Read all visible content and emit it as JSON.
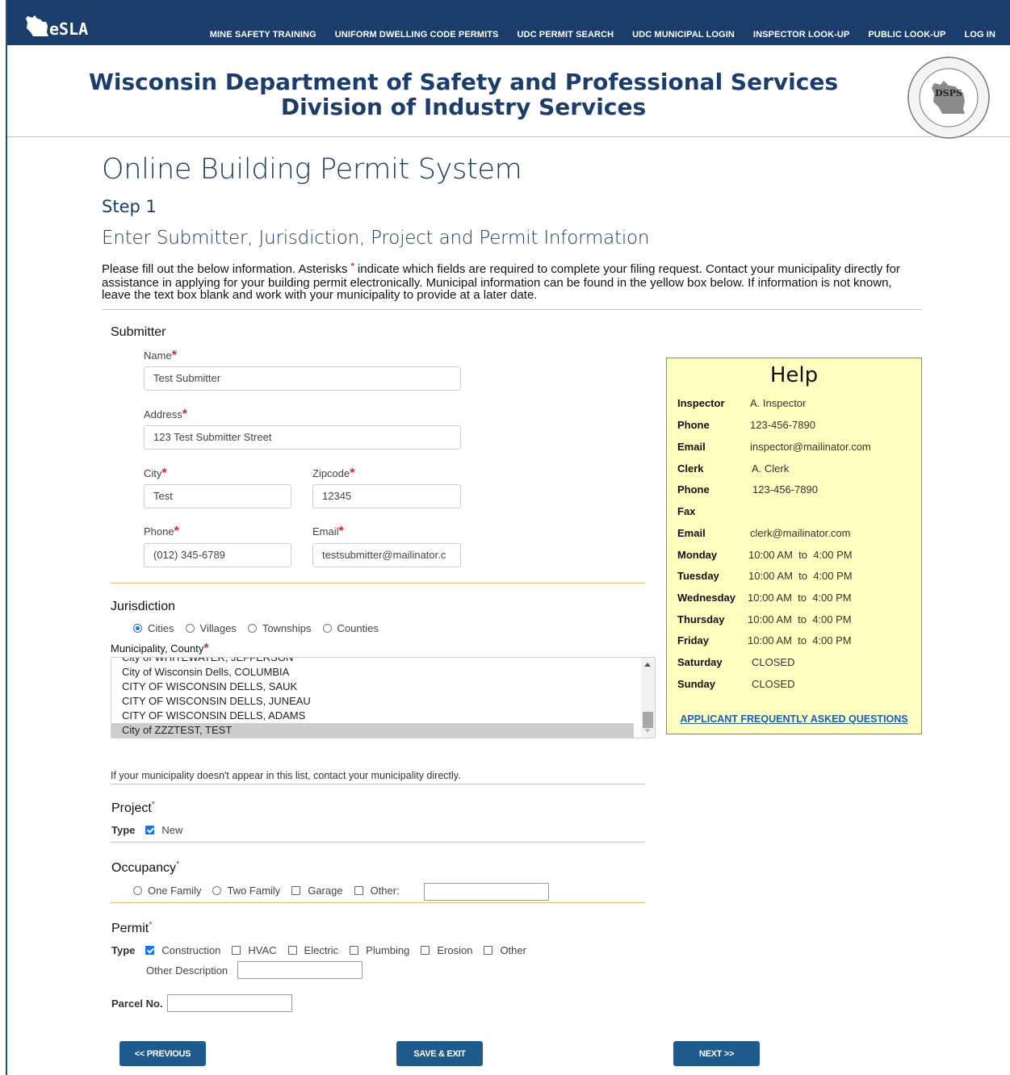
{
  "nav": {
    "logo_text": "eSLA",
    "links": [
      "MINE SAFETY TRAINING",
      "UNIFORM DWELLING CODE PERMITS",
      "UDC PERMIT SEARCH",
      "UDC MUNICIPAL LOGIN",
      "INSPECTOR LOOK-UP",
      "PUBLIC LOOK-UP",
      "LOG IN"
    ]
  },
  "banner": {
    "line1": "Wisconsin Department of Safety and Professional Services",
    "line2": "Division of Industry Services",
    "seal_text": "WISCONSIN DEPARTMENT OF SAFETY AND PROFESSIONAL SERVICES",
    "seal_letters": "DSPS"
  },
  "page": {
    "title": "Online Building Permit System",
    "step": "Step 1",
    "subtitle": "Enter Submitter, Jurisdiction, Project and Permit Information",
    "intro_a": "Please fill out the below information. Asterisks ",
    "intro_star": "*",
    "intro_b": " indicate which fields are required to complete your filing request. Contact your municipality directly for assistance in applying for your building permit electronically. Municipal information can be found in the yellow box below. If information is not known, leave the text box blank and work with your municipality to provide at a later date."
  },
  "submitter": {
    "heading": "Submitter",
    "name_label": "Name",
    "name_value": "Test Submitter",
    "address_label": "Address",
    "address_value": "123 Test Submitter Street",
    "city_label": "City",
    "city_value": "Test",
    "zip_label": "Zipcode",
    "zip_value": "12345",
    "phone_label": "Phone",
    "phone_value": "(012) 345-6789",
    "email_label": "Email",
    "email_value": "testsubmitter@mailinator.c",
    "required_mark": "*"
  },
  "jurisdiction": {
    "heading": "Jurisdiction",
    "options": [
      "Cities",
      "Villages",
      "Townships",
      "Counties"
    ],
    "selected": "Cities",
    "municipality_label": "Municipality, County",
    "list_partial": "City of WHITEWATER, JEFFERSON",
    "list_items": [
      "City of Wisconsin Dells, COLUMBIA",
      "CITY OF WISCONSIN DELLS, SAUK",
      "CITY OF WISCONSIN DELLS, JUNEAU",
      "CITY OF WISCONSIN DELLS, ADAMS",
      "City of ZZZTEST, TEST"
    ],
    "selected_item": "City of ZZZTEST, TEST",
    "note": "If your municipality doesn't appear in this list, contact your municipality directly."
  },
  "help": {
    "title": "Help",
    "rows": [
      {
        "key": "Inspector",
        "value": "A. Inspector"
      },
      {
        "key": "Phone",
        "value": "123-456-7890"
      },
      {
        "key": "Email",
        "value": "inspector@mailinator.com"
      },
      {
        "key": "Clerk",
        "value": "A. Clerk"
      },
      {
        "key": "Phone",
        "value": "123-456-7890"
      },
      {
        "key": "Fax",
        "value": ""
      },
      {
        "key": "Email",
        "value": "clerk@mailinator.com"
      },
      {
        "key": "Monday",
        "value": "10:00 AM  to  4:00 PM"
      },
      {
        "key": "Tuesday",
        "value": "10:00 AM  to  4:00 PM"
      },
      {
        "key": "Wednesday",
        "value": "10:00 AM  to  4:00 PM"
      },
      {
        "key": "Thursday",
        "value": "10:00 AM  to  4:00 PM"
      },
      {
        "key": "Friday",
        "value": "10:00 AM  to  4:00 PM"
      },
      {
        "key": "Saturday",
        "value": "CLOSED"
      },
      {
        "key": "Sunday",
        "value": "CLOSED"
      }
    ],
    "faq_link": "APPLICANT FREQUENTLY ASKED QUESTIONS"
  },
  "project": {
    "heading": "Project",
    "type_label": "Type",
    "option": "New",
    "checked": true
  },
  "occupancy": {
    "heading": "Occupancy",
    "options": [
      "One Family",
      "Two Family",
      "Garage",
      "Other:"
    ],
    "other_value": ""
  },
  "permit": {
    "heading": "Permit",
    "type_label": "Type",
    "options": [
      "Construction",
      "HVAC",
      "Electric",
      "Plumbing",
      "Erosion",
      "Other"
    ],
    "checked": "Construction",
    "other_desc_label": "Other Description",
    "other_desc_value": "",
    "parcel_label": "Parcel No.",
    "parcel_value": ""
  },
  "buttons": {
    "previous": "<< PREVIOUS",
    "save_exit": "SAVE & EXIT",
    "next": "NEXT >>"
  },
  "colors": {
    "nav_bg": "#1a3d6b",
    "accent_rule": "#e8c07a",
    "help_bg": "#ffffc0",
    "required": "#d9262b",
    "button": "#1f5a8c"
  }
}
